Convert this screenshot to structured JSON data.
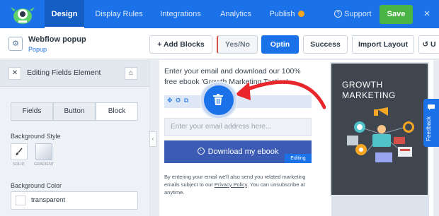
{
  "topbar": {
    "tabs": [
      "Design",
      "Display Rules",
      "Integrations",
      "Analytics",
      "Publish"
    ],
    "publish_badge": "!",
    "support": "Support",
    "save": "Save",
    "close": "×"
  },
  "campaign": {
    "name": "Webflow popup",
    "type": "Popup"
  },
  "toolbar": {
    "add_blocks": "+ Add Blocks",
    "yes_no": "Yes/No",
    "optin": "Optin",
    "success": "Success",
    "import_layout": "Import Layout",
    "undo_partial": "↺ U"
  },
  "panel": {
    "title": "Editing Fields Element",
    "tabs": [
      "Fields",
      "Button",
      "Block"
    ],
    "background_style_label": "Background Style",
    "style_options": [
      "SOLID",
      "GRADIENT"
    ],
    "background_color_label": "Background Color",
    "background_color_value": "transparent"
  },
  "popup": {
    "headline": "Enter your email and download our 100% free ebook 'Growth Marketing Tactics'",
    "email_placeholder": "Enter your email address here...",
    "button_label": "Download my ebook",
    "editing_tag": "Editing",
    "disclaimer_before": "By entering your email we'll also send you related marketing emails subject to our ",
    "privacy_link": "Privacy Policy",
    "disclaimer_after": ". You can unsubscribe at anytime.",
    "book_title_line1": "GROWTH",
    "book_title_line2": "MARKETING"
  },
  "feedback": "Feedback",
  "colors": {
    "brand_blue": "#1b72e8",
    "save_green": "#4bb543",
    "button_blue": "#3b5bb5",
    "arrow_red": "#e8262b",
    "book_bg": "#3f464f"
  }
}
